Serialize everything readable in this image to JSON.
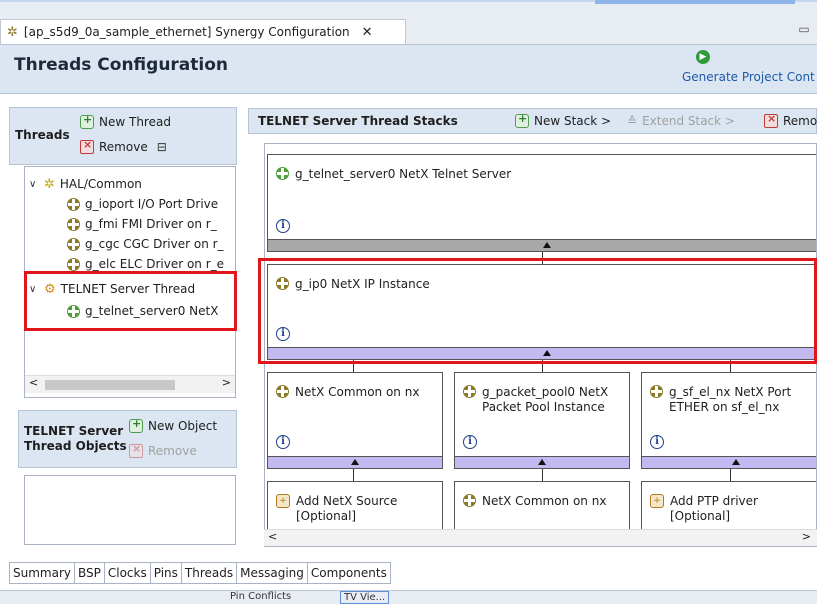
{
  "editor_tab": {
    "title": "[ap_s5d9_0a_sample_ethernet] Synergy Configuration",
    "close": "✕"
  },
  "header": {
    "title": "Threads Configuration",
    "generate_label": "Generate Project Cont"
  },
  "threads": {
    "label": "Threads",
    "new_thread": "New Thread",
    "remove": "Remove",
    "tree": [
      {
        "label": "HAL/Common",
        "type": "group"
      },
      {
        "label": "g_ioport I/O Port Drive",
        "type": "module"
      },
      {
        "label": "g_fmi FMI Driver on r_",
        "type": "module"
      },
      {
        "label": "g_cgc CGC Driver on r_",
        "type": "module"
      },
      {
        "label": "g_elc ELC Driver on r_e",
        "type": "module"
      },
      {
        "label": "TELNET Server Thread",
        "type": "group"
      },
      {
        "label": "g_telnet_server0 NetX",
        "type": "module"
      }
    ]
  },
  "objects": {
    "label_line1": "TELNET Server",
    "label_line2": "Thread Objects",
    "new_object": "New Object",
    "remove": "Remove"
  },
  "stacks": {
    "title": "TELNET Server Thread Stacks",
    "new_stack": "New Stack >",
    "extend_stack": "Extend Stack >",
    "remove": "Remo",
    "cards": {
      "telnet": "g_telnet_server0 NetX Telnet Server",
      "ip": "g_ip0 NetX IP Instance",
      "common1": "NetX Common on nx",
      "packet_l1": "g_packet_pool0 NetX",
      "packet_l2": "Packet Pool Instance",
      "sfel_l1": "g_sf_el_nx NetX Port",
      "sfel_l2": "ETHER on sf_el_nx",
      "addsrc_l1": "Add NetX Source",
      "addsrc_l2": "[Optional]",
      "common2": "NetX Common on nx",
      "ptp_l1": "Add PTP driver",
      "ptp_l2": "[Optional]"
    },
    "info_symbol": "i"
  },
  "bottom_tabs": [
    "Summary",
    "BSP",
    "Clocks",
    "Pins",
    "Threads",
    "Messaging",
    "Components"
  ],
  "status": {
    "pin_conflicts": "Pin Conflicts",
    "tv": "TV Vie..."
  },
  "colors": {
    "highlight": "#e0161b",
    "header_bg": "#dce6f2",
    "bar_purple": "#c4b8f0",
    "bar_gray": "#a9a9a9"
  }
}
